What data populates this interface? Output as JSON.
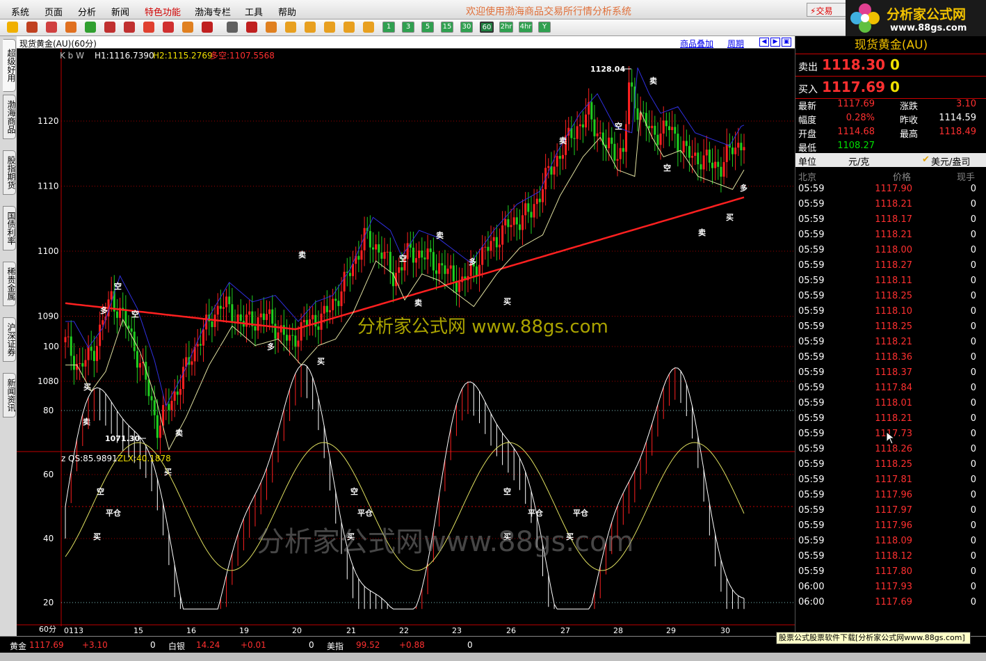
{
  "menu": {
    "items": [
      "系统",
      "页面",
      "分析",
      "新闻",
      "特色功能",
      "渤海专栏",
      "工具",
      "帮助"
    ],
    "title": "欢迎使用渤海商品交易所行情分析系统",
    "trade_button": "交易"
  },
  "logo": {
    "name": "分析家公式网",
    "url": "www.88gs.com"
  },
  "toolbar": {
    "periods": [
      "1",
      "3",
      "5",
      "15",
      "30",
      "60",
      "2hr",
      "4hr",
      "Y"
    ]
  },
  "side_tabs": [
    "超级好用",
    "渤海商品",
    "股指期货",
    "国债利率",
    "稀贵金属",
    "沪深证券",
    "新闻资讯"
  ],
  "chart": {
    "title": "现货黄金(AU)(60分)",
    "overlay_link": "商品叠加",
    "period_link": "周期",
    "legend": {
      "prefix": "K b W",
      "h1": "H1:1116.7390",
      "h2": "H2:1115.2769",
      "dk": "多空:1107.5568"
    },
    "high_label": "1128.04",
    "low_label": "1071.30",
    "watermark": "分析家公式网 www.88gs.com",
    "watermark2": "分析家公式网www.88gs.com",
    "sub_legend": {
      "z": "z",
      "qs": "QS:85.9891",
      "zlx": "ZLX:40.1878"
    },
    "period_label": "60分",
    "signals": [
      "卖",
      "买",
      "多",
      "空",
      "平仓"
    ]
  },
  "chart_data": [
    {
      "type": "candlestick",
      "y_ticks": [
        1080,
        1090,
        1100,
        1110,
        1120
      ],
      "ylim": [
        1070,
        1130
      ],
      "x_labels": [
        "0113",
        "15",
        "16",
        "19",
        "20",
        "21",
        "22",
        "23",
        "26",
        "27",
        "28",
        "29",
        "30"
      ],
      "high": 1128.04,
      "low": 1071.3,
      "series": [
        {
          "name": "H1",
          "value": 1116.739
        },
        {
          "name": "H2",
          "value": 1115.2769
        },
        {
          "name": "多空",
          "value": 1107.5568
        }
      ]
    },
    {
      "type": "line",
      "y_ticks": [
        20,
        40,
        60,
        80,
        100
      ],
      "ylim": [
        0,
        100
      ],
      "series": [
        {
          "name": "QS",
          "value": 85.9891
        },
        {
          "name": "ZLX",
          "value": 40.1878
        }
      ]
    }
  ],
  "quote": {
    "name": "现货黄金(AU)",
    "sell_label": "卖出",
    "sell_price": "1118.30",
    "sell_vol": "0",
    "buy_label": "买入",
    "buy_price": "1117.69",
    "buy_vol": "0",
    "stats": [
      {
        "label": "最新",
        "value": "1117.69"
      },
      {
        "label": "涨跌",
        "value": "3.10"
      },
      {
        "label": "幅度",
        "value": "0.28%"
      },
      {
        "label": "昨收",
        "value": "1114.59"
      },
      {
        "label": "开盘",
        "value": "1114.68"
      },
      {
        "label": "最高",
        "value": "1118.49"
      },
      {
        "label": "最低",
        "value": "1108.27"
      }
    ],
    "unit_label": "单位",
    "unit_value": "元/克",
    "currency": "美元/盎司",
    "tick_header": [
      "北京",
      "价格",
      "现手"
    ],
    "ticks": [
      [
        "05:59",
        "1117.90",
        "0"
      ],
      [
        "05:59",
        "1118.21",
        "0"
      ],
      [
        "05:59",
        "1118.17",
        "0"
      ],
      [
        "05:59",
        "1118.21",
        "0"
      ],
      [
        "05:59",
        "1118.00",
        "0"
      ],
      [
        "05:59",
        "1118.27",
        "0"
      ],
      [
        "05:59",
        "1118.11",
        "0"
      ],
      [
        "05:59",
        "1118.25",
        "0"
      ],
      [
        "05:59",
        "1118.10",
        "0"
      ],
      [
        "05:59",
        "1118.25",
        "0"
      ],
      [
        "05:59",
        "1118.21",
        "0"
      ],
      [
        "05:59",
        "1118.36",
        "0"
      ],
      [
        "05:59",
        "1118.37",
        "0"
      ],
      [
        "05:59",
        "1117.84",
        "0"
      ],
      [
        "05:59",
        "1118.01",
        "0"
      ],
      [
        "05:59",
        "1118.21",
        "0"
      ],
      [
        "05:59",
        "1117.73",
        "0"
      ],
      [
        "05:59",
        "1118.26",
        "0"
      ],
      [
        "05:59",
        "1118.25",
        "0"
      ],
      [
        "05:59",
        "1117.81",
        "0"
      ],
      [
        "05:59",
        "1117.96",
        "0"
      ],
      [
        "05:59",
        "1117.97",
        "0"
      ],
      [
        "05:59",
        "1117.96",
        "0"
      ],
      [
        "05:59",
        "1118.09",
        "0"
      ],
      [
        "05:59",
        "1118.12",
        "0"
      ],
      [
        "05:59",
        "1117.80",
        "0"
      ],
      [
        "06:00",
        "1117.93",
        "0"
      ],
      [
        "06:00",
        "1117.69",
        "0"
      ]
    ]
  },
  "status": {
    "gold_label": "黄金",
    "gold_price": "1117.69",
    "gold_change": "+3.10",
    "gold_vol": "0",
    "silver_label": "白银",
    "silver_price": "14.24",
    "silver_change": "+0.01",
    "silver_vol": "0",
    "usd_label": "美指",
    "usd_price": "99.52",
    "usd_change": "+0.88",
    "usd_vol": "0",
    "ad": "股票公式股票软件下载[分析家公式网www.88gs.com]"
  }
}
